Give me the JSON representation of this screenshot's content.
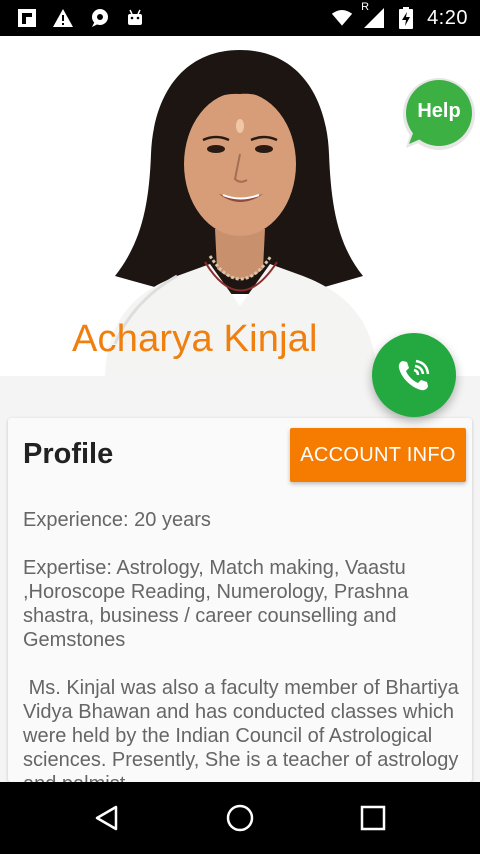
{
  "status_bar": {
    "time": "4:20",
    "network_label": "R",
    "left_icons": [
      "flipboard-icon",
      "warning-icon",
      "chat-bubble-icon",
      "android-icon"
    ],
    "right_icons": [
      "wifi-icon",
      "signal-icon",
      "battery-charging-icon"
    ]
  },
  "hero": {
    "name": "Acharya Kinjal",
    "name_color": "#f07f0e"
  },
  "help": {
    "label": "Help",
    "color": "#3cb043"
  },
  "call": {
    "icon": "phone-ring-icon",
    "color": "#23a93f"
  },
  "profile": {
    "title": "Profile",
    "account_button": "ACCOUNT INFO",
    "account_button_color": "#f57c00",
    "experience": "Experience: 20 years",
    "expertise": "Expertise: Astrology, Match making, Vaastu ,Horoscope Reading, Numerology, Prashna shastra, business / career counselling and Gemstones",
    "bio": " Ms. Kinjal was also a faculty member of Bhartiya Vidya Bhawan and has conducted classes which were held by the Indian Council of Astrological sciences. Presently, She is a teacher of astrology and palmist"
  },
  "nav": {
    "back": "back-icon",
    "home": "home-icon",
    "recents": "recents-icon"
  }
}
